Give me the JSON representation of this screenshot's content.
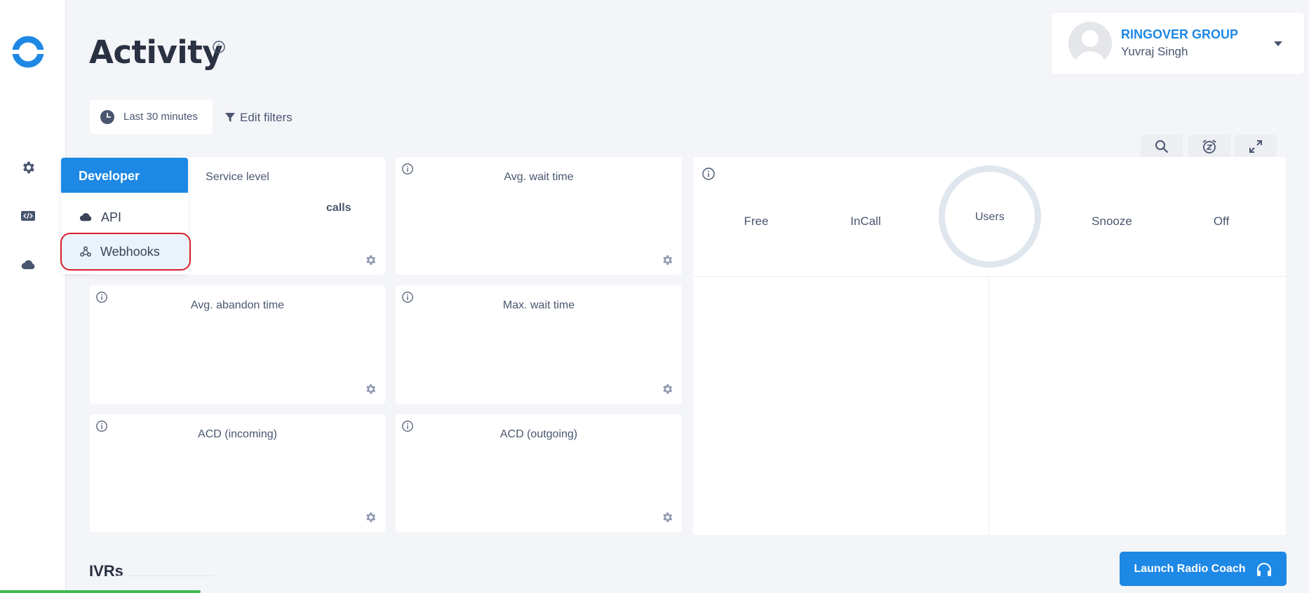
{
  "header": {
    "title": "Activity"
  },
  "account": {
    "company": "RINGOVER GROUP",
    "user": "Yuvraj Singh"
  },
  "filters": {
    "time_range": "Last 30 minutes",
    "edit_label": "Edit filters"
  },
  "developer_menu": {
    "header": "Developer",
    "items": [
      {
        "label": "API",
        "icon": "cloud-icon"
      },
      {
        "label": "Webhooks",
        "icon": "webhook-icon"
      }
    ]
  },
  "cards": {
    "service_level": {
      "title": "Service level",
      "extra": "calls"
    },
    "avg_wait_time": {
      "title": "Avg. wait time"
    },
    "avg_abandon_time": {
      "title": "Avg. abandon time"
    },
    "max_wait_time": {
      "title": "Max. wait time"
    },
    "acd_incoming": {
      "title": "ACD (incoming)"
    },
    "acd_outgoing": {
      "title": "ACD (outgoing)"
    }
  },
  "users_panel": {
    "center": "Users",
    "statuses": [
      "Free",
      "InCall",
      "Snooze",
      "Off"
    ]
  },
  "ivrs": {
    "title": "IVRs"
  },
  "coach": {
    "label": "Launch Radio Coach"
  },
  "colors": {
    "accent": "#1e88e5",
    "highlight_ring": "#d6202b",
    "background": "#f4f5f8"
  }
}
